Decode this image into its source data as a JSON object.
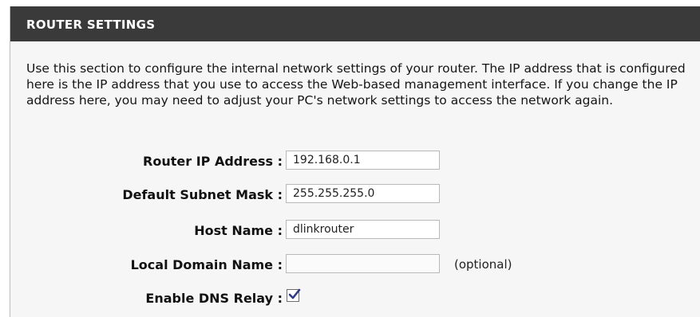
{
  "section": {
    "title": "ROUTER SETTINGS",
    "description": "Use this section to configure the internal network settings of your router. The IP address that is configured here is the IP address that you use to access the Web-based management interface. If you change the IP address here, you may need to adjust your PC's network settings to access the network again."
  },
  "form": {
    "router_ip": {
      "label": "Router IP Address :",
      "value": "192.168.0.1"
    },
    "subnet_mask": {
      "label": "Default Subnet Mask :",
      "value": "255.255.255.0"
    },
    "host_name": {
      "label": "Host Name :",
      "value": "dlinkrouter"
    },
    "local_domain": {
      "label": "Local Domain Name :",
      "value": "",
      "hint": "(optional)"
    },
    "dns_relay": {
      "label": "Enable DNS Relay :",
      "checked": true,
      "icon": "checkmark-icon"
    }
  },
  "colors": {
    "title_bar": "#3a3a3a",
    "panel_bg": "#f6f6f6",
    "checkmark": "#2c3a8f"
  }
}
